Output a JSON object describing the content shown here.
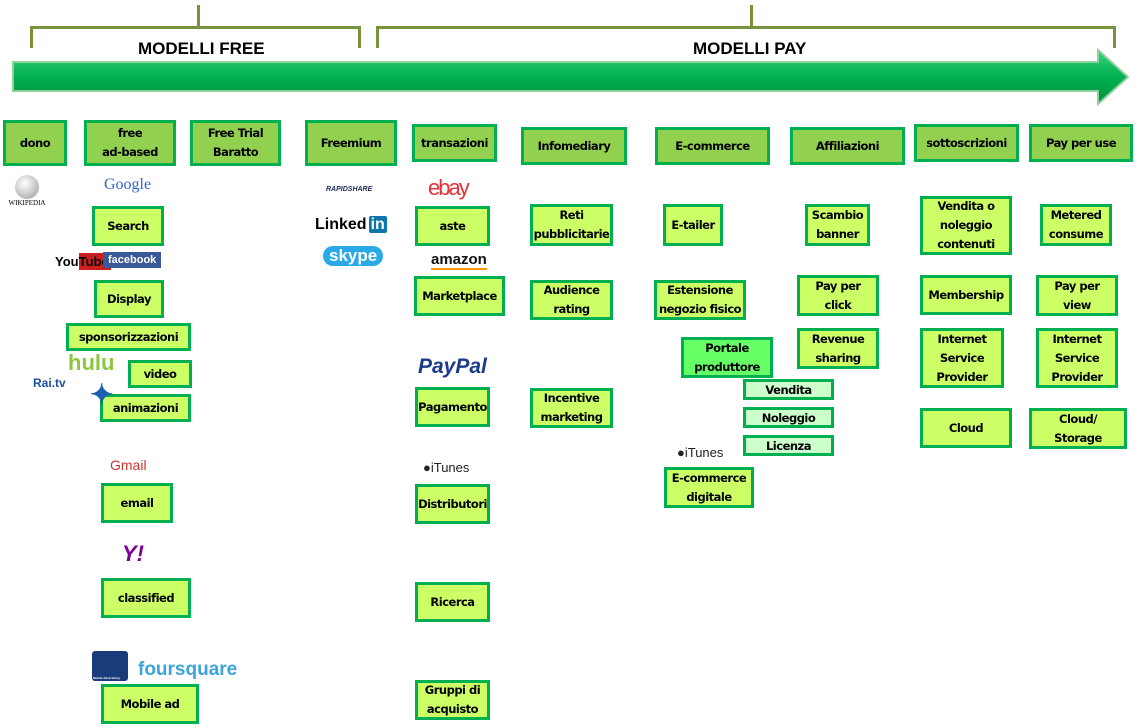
{
  "header": {
    "free_label": "MODELLI FREE",
    "pay_label": "MODELLI PAY"
  },
  "categories": [
    "dono",
    "free\nad-based",
    "Free Trial\nBaratto",
    "Freemium",
    "transazioni",
    "Infomediary",
    "E-commerce",
    "Affiliazioni",
    "sottoscrizioni",
    "Pay per use"
  ],
  "items": {
    "search": "Search",
    "display": "Display",
    "sponsorizzazioni": "sponsorizzazioni",
    "video": "video",
    "animazioni": "animazioni",
    "email": "email",
    "classified": "classified",
    "mobile_ad": "Mobile ad",
    "aste": "aste",
    "marketplace": "Marketplace",
    "pagamento": "Pagamento",
    "distributori": "Distributori",
    "ricerca": "Ricerca",
    "gruppi": "Gruppi di\nacquisto",
    "reti": "Reti\npubblicitarie",
    "audience": "Audience\nrating",
    "incentive": "Incentive\nmarketing",
    "etailer": "E-tailer",
    "estensione": "Estensione\nnegozio fisico",
    "portale": "Portale\nproduttore",
    "vendita": "Vendita",
    "noleggio": "Noleggio",
    "licenza": "Licenza",
    "ecommerce_digitale": "E-commerce\ndigitale",
    "scambio": "Scambio\nbanner",
    "ppc": "Pay per\nclick",
    "revenue": "Revenue\nsharing",
    "vendita_noleggio": "Vendita o\nnoleggio\ncontenuti",
    "membership": "Membership",
    "isp1": "Internet\nService\nProvider",
    "cloud": "Cloud",
    "metered": "Metered\nconsume",
    "ppv": "Pay per\nview",
    "isp2": "Internet\nService\nProvider",
    "cloud_storage": "Cloud/\nStorage"
  },
  "logos": {
    "wikipedia": "Wikipedia",
    "google": "Google",
    "youtube": "YouTube",
    "facebook": "facebook",
    "hulu": "hulu",
    "raitv": "Rai.tv",
    "gmail": "Gmail",
    "yahoo": "Y!",
    "mobile": "Mobile Advertising",
    "foursquare": "foursquare",
    "rapidshare": "RAPIDSHARE",
    "linkedin": "Linked",
    "linkedin_in": "in",
    "skype": "skype",
    "ebay": "ebay",
    "amazon": "amazon",
    "paypal": "PayPal",
    "itunes": "iTunes"
  },
  "colors": {
    "arrow": "#00b050",
    "category": "#92d050",
    "item": "#ccff66",
    "portale": "#66ff66",
    "license": "#ccffcc",
    "border": "#00b050",
    "bracket": "#77933c"
  }
}
